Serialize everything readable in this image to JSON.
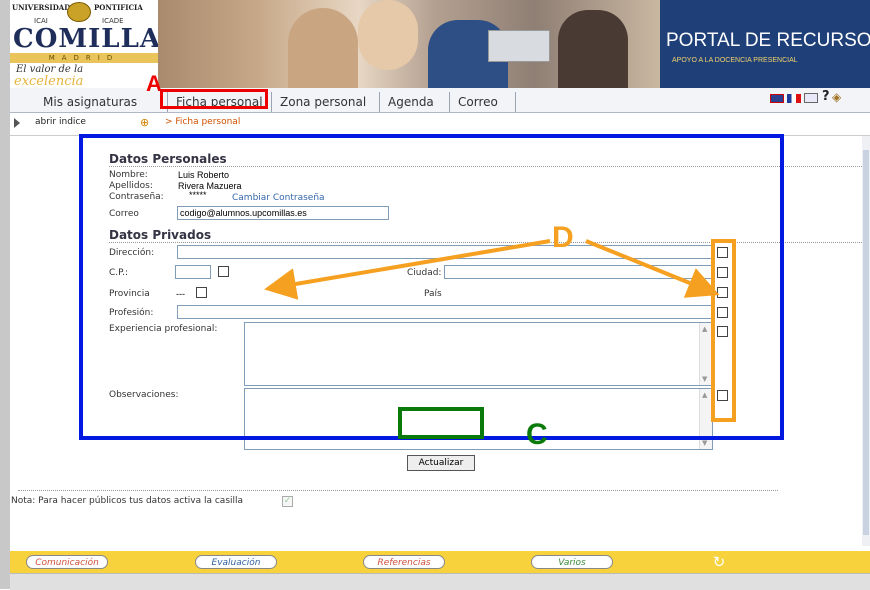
{
  "header": {
    "logo": {
      "universidad": "UNIVERSIDAD",
      "pontificia": "PONTIFICIA",
      "icai": "ICAI",
      "icade": "ICADE",
      "comillas": "COMILLAS",
      "madrid": "MADRID",
      "valor": "El valor de la",
      "excelencia": "excelencia"
    },
    "portal_title": "PORTAL DE RECURSOS",
    "portal_subtitle": "APOYO A LA DOCENCIA PRESENCIAL"
  },
  "tabs": [
    {
      "label": "Mis asignaturas"
    },
    {
      "label": "Ficha personal"
    },
    {
      "label": "Zona personal"
    },
    {
      "label": "Agenda"
    },
    {
      "label": "Correo"
    }
  ],
  "breadcrumb": {
    "toggle_label": "abrir indice",
    "current": "> Ficha personal"
  },
  "form": {
    "datos_personales": {
      "title": "Datos Personales",
      "nombre_label": "Nombre:",
      "nombre_value": "Luis Roberto",
      "apellidos_label": "Apellidos:",
      "apellidos_value": "Rivera Mazuera",
      "contrasena_label": "Contraseña:",
      "contrasena_value": "*****",
      "cambiar_link": "Cambiar Contraseña",
      "correo_label": "Correo",
      "correo_value": "codigo@alumnos.upcomillas.es"
    },
    "datos_privados": {
      "title": "Datos Privados",
      "direccion_label": "Dirección:",
      "cp_label": "C.P.:",
      "ciudad_label": "Ciudad:",
      "provincia_label": "Provincia",
      "provincia_value": "---",
      "pais_label": "País",
      "pais_value": "---",
      "profesion_label": "Profesión:",
      "experiencia_label": "Experiencia profesional:",
      "observaciones_label": "Observaciones:"
    },
    "submit_label": "Actualizar",
    "note": "Nota: Para hacer públicos tus datos activa la casilla"
  },
  "bottom_nav": [
    {
      "label": "Comunicación",
      "color": "#d0503a"
    },
    {
      "label": "Evaluación",
      "color": "#3060a0"
    },
    {
      "label": "Referencias",
      "color": "#d0503a"
    },
    {
      "label": "Varios",
      "color": "#3a8a3a"
    }
  ],
  "annotations": {
    "a": "A",
    "c": "C",
    "d": "D"
  },
  "colors": {
    "annotation_red": "#e00000",
    "annotation_blue": "#0018e0",
    "annotation_green": "#0a7a0a",
    "annotation_orange": "#f5a020",
    "portal_bg": "#1f3f78",
    "bottom_bar": "#f7d23c"
  }
}
